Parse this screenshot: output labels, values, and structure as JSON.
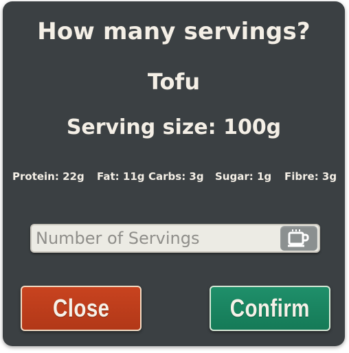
{
  "dialog": {
    "title": "How many servings?",
    "food_name": "Tofu",
    "serving_size": "Serving size: 100g"
  },
  "nutrients": [
    {
      "label": "Protein: 22g"
    },
    {
      "label": "Fat: 11g"
    },
    {
      "label": "Carbs: 3g"
    },
    {
      "label": "Sugar: 1g"
    },
    {
      "label": "Fibre: 3g"
    }
  ],
  "servings_input": {
    "placeholder": "Number of Servings",
    "value": "",
    "icon": "cup-icon"
  },
  "buttons": {
    "close_label": "Close",
    "confirm_label": "Confirm"
  },
  "colors": {
    "dialog_bg": "#3b4043",
    "close": "#c8431f",
    "confirm": "#1f8f6a",
    "text": "#f4efe6"
  }
}
